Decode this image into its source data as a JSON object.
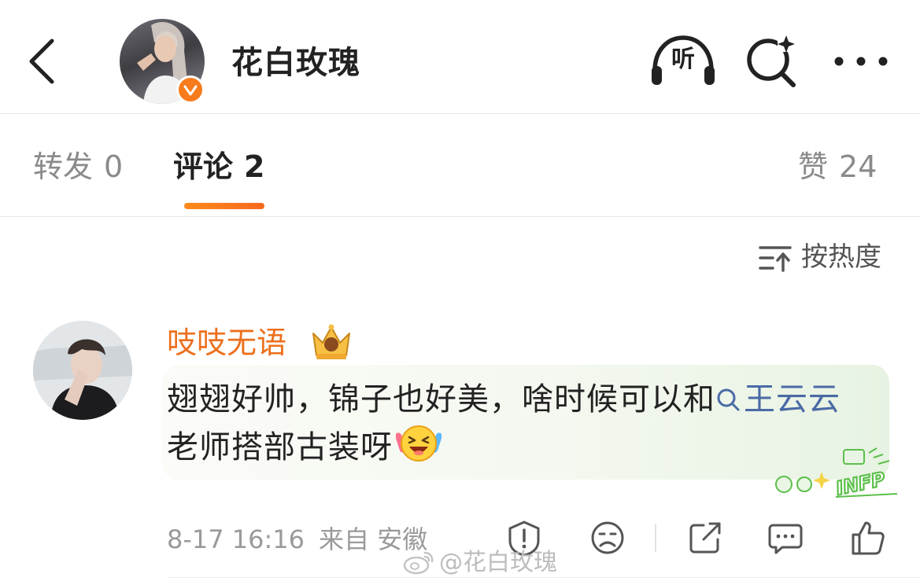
{
  "header": {
    "title": "花白玫瑰",
    "listen_label": "听"
  },
  "tabs": [
    {
      "label": "转发",
      "count": "0",
      "active": false
    },
    {
      "label": "评论",
      "count": "2",
      "active": true
    },
    {
      "label": "赞",
      "count": "24",
      "active": false
    }
  ],
  "sort": {
    "label": "按热度"
  },
  "comment": {
    "username": "吱吱无语",
    "text_before": "翅翅好帅，锦子也好美，啥时候可以和",
    "mention": "王云云",
    "text_after": "老师搭部古装呀",
    "timestamp": "8-17 16:16",
    "source": "来自 安徽",
    "sticker_text": "INFP"
  },
  "watermark": "@花白玫瑰",
  "colors": {
    "accent_orange": "#f77b1b",
    "username_orange": "#ec6f1d",
    "mention_blue": "#4a6aa5",
    "tab_inactive": "#8a8a8a",
    "sticker_green": "#5bbf4a"
  },
  "icons": [
    "back-icon",
    "verified-icon",
    "headphones-icon",
    "search-sparkle-icon",
    "more-icon",
    "sort-icon",
    "crown-badge-icon",
    "search-icon",
    "laugh-cry-emoji",
    "report-icon",
    "dislike-face-icon",
    "share-icon",
    "comment-icon",
    "like-icon",
    "weibo-logo"
  ]
}
